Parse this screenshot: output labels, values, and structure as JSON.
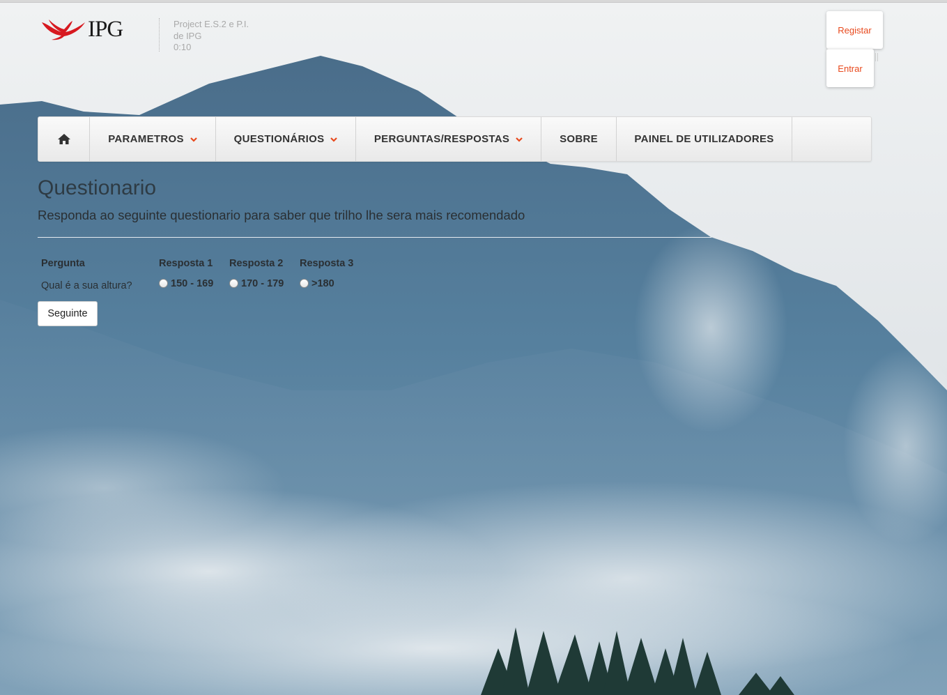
{
  "header": {
    "logo_text": "IPG",
    "project_line1": "Project E.S.2 e P.I.",
    "project_line2": "de IPG",
    "project_line3": "0:10"
  },
  "auth": {
    "register_label": "Registar",
    "login_label": "Entrar"
  },
  "nav": {
    "home_icon": "home-icon",
    "items": [
      {
        "label": "PARAMETROS",
        "dropdown": true
      },
      {
        "label": "QUESTIONÁRIOS",
        "dropdown": true
      },
      {
        "label": "PERGUNTAS/RESPOSTAS",
        "dropdown": true
      },
      {
        "label": "SOBRE",
        "dropdown": false
      },
      {
        "label": "PAINEL DE UTILIZADORES",
        "dropdown": false
      }
    ]
  },
  "main": {
    "title": "Questionario",
    "subtitle": "Responda ao seguinte questionario para saber que trilho lhe sera mais recomendado",
    "table": {
      "headers": [
        "Pergunta",
        "Resposta 1",
        "Resposta 2",
        "Resposta 3"
      ],
      "question": "Qual é a sua altura?",
      "answers": [
        "150 - 169",
        "170 - 179",
        ">180"
      ],
      "selected_answer": null
    },
    "next_button": "Seguinte"
  },
  "colors": {
    "accent": "#e8491d",
    "logo_red": "#d71920",
    "text_dark": "#2a2f33"
  }
}
